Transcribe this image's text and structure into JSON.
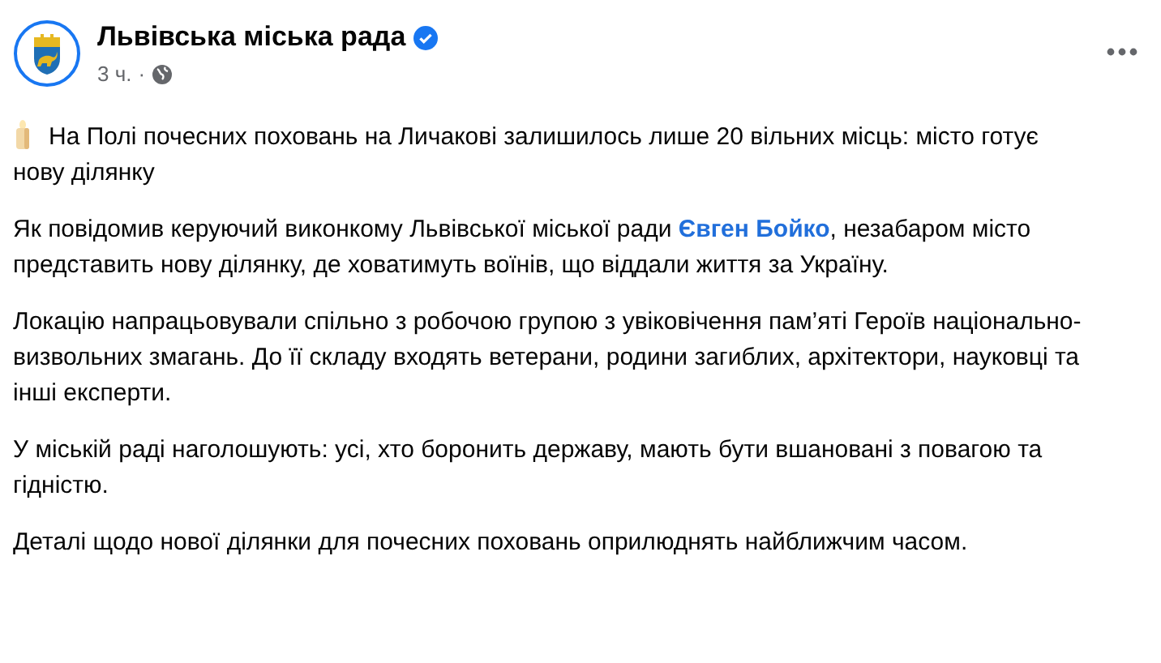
{
  "post": {
    "author": "Львівська міська рада",
    "verified": true,
    "time": "3 ч.",
    "separator": "·"
  },
  "paragraphs": [
    {
      "parts": [
        {
          "kind": "text",
          "text": "На Полі почесних поховань на Личакові залишилось лише 20 вільних місць: місто готує нову ділянку"
        }
      ],
      "lead_icon": true
    },
    {
      "parts": [
        {
          "kind": "text",
          "text": "Як повідомив керуючий виконкому Львівської міської ради "
        },
        {
          "kind": "link",
          "text": "Євген Бойко"
        },
        {
          "kind": "text",
          "text": ", незабаром місто представить нову ділянку, де ховатимуть воїнів, що віддали життя за Україну."
        }
      ],
      "lead_icon": false
    },
    {
      "parts": [
        {
          "kind": "text",
          "text": "Локацію напрацьовували спільно з робочою групою з увіковічення пам’яті Героїв національно-визвольних змагань. До її складу входять ветерани, родини загиблих, архітектори, науковці та інші експерти."
        }
      ],
      "lead_icon": false
    },
    {
      "parts": [
        {
          "kind": "text",
          "text": "У міській раді наголошують: усі, хто боронить державу, мають бути вшановані з повагою та гідністю."
        }
      ],
      "lead_icon": false
    },
    {
      "parts": [
        {
          "kind": "text",
          "text": "Деталі щодо нової ділянки для почесних поховань оприлюднять найближчим часом."
        }
      ],
      "lead_icon": false
    }
  ]
}
